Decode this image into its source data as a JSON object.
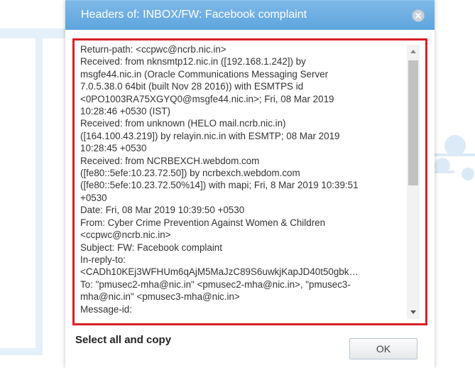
{
  "dialog": {
    "title": "Headers of: INBOX/FW: Facebook complaint",
    "close_icon": "close-icon",
    "header_lines": [
      "Return-path: <ccpwc@ncrb.nic.in>",
      "Received: from nknsmtp12.nic.in ([192.168.1.242]) by",
      "msgfe44.nic.in (Oracle Communications Messaging Server",
      "7.0.5.38.0 64bit (built Nov 28 2016)) with ESMTPS id",
      "<0PO1003RA75XGYQ0@msgfe44.nic.in>; Fri, 08 Mar 2019",
      "10:28:46 +0530 (IST)",
      "Received: from unknown (HELO mail.ncrb.nic.in)",
      "([164.100.43.219]) by relayin.nic.in with ESMTP; 08 Mar 2019",
      "10:28:45 +0530",
      "Received: from NCRBEXCH.webdom.com",
      "([fe80::5efe:10.23.72.50]) by ncrbexch.webdom.com",
      "([fe80::5efe:10.23.72.50%14]) with mapi; Fri, 8 Mar 2019 10:39:51",
      "+0530",
      "Date: Fri, 08 Mar 2019 10:39:50 +0530",
      "From: Cyber Crime Prevention Against Women & Children",
      "<ccpwc@ncrb.nic.in>",
      "Subject: FW: Facebook complaint",
      "In-reply-to:",
      "<CADh10KEj3WFHUm6qAjM5MaJzC89S6uwkjKapJD40t50gbk…",
      "To: \"pmusec2-mha@nic.in\" <pmusec2-mha@nic.in>, \"pmusec3-",
      "mha@nic.in\" <pmusec3-mha@nic.in>",
      "Message-id:"
    ],
    "instruction": "Select all and copy",
    "ok_label": "OK"
  },
  "colors": {
    "titlebar": "#6aaee2",
    "highlight_border": "#d91f26"
  }
}
